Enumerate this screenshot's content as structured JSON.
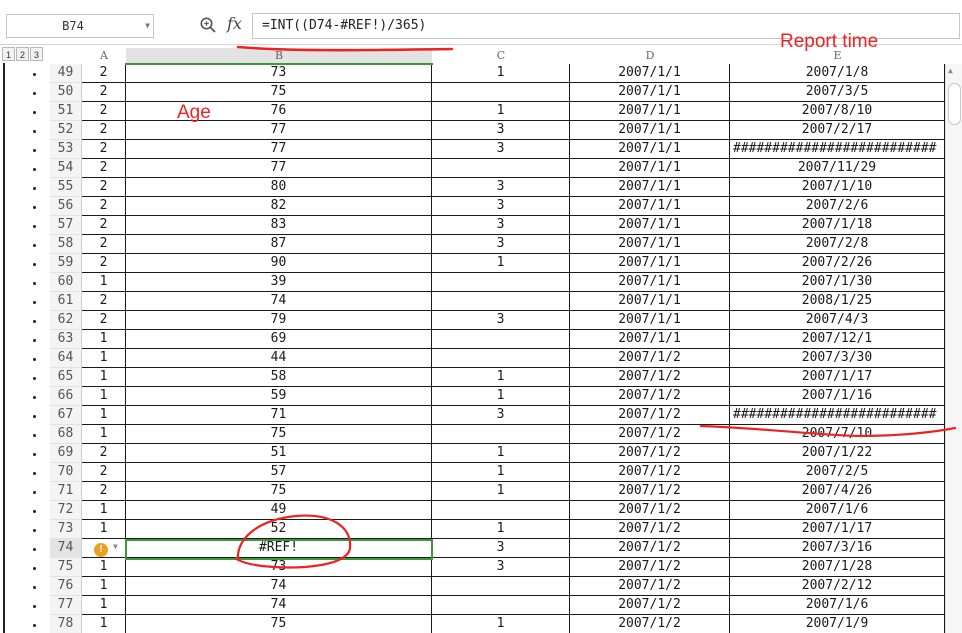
{
  "name_box": "B74",
  "formula": "=INT((D74-#REF!)/365)",
  "outline_levels": [
    "1",
    "2",
    "3"
  ],
  "columns": [
    "A",
    "B",
    "C",
    "D",
    "E"
  ],
  "rows": [
    {
      "n": "49",
      "a": "2",
      "b": "73",
      "c": "1",
      "d": "2007/1/1",
      "e": "2007/1/8"
    },
    {
      "n": "50",
      "a": "2",
      "b": "75",
      "c": "",
      "d": "2007/1/1",
      "e": "2007/3/5"
    },
    {
      "n": "51",
      "a": "2",
      "b": "76",
      "c": "1",
      "d": "2007/1/1",
      "e": "2007/8/10"
    },
    {
      "n": "52",
      "a": "2",
      "b": "77",
      "c": "3",
      "d": "2007/1/1",
      "e": "2007/2/17"
    },
    {
      "n": "53",
      "a": "2",
      "b": "77",
      "c": "3",
      "d": "2007/1/1",
      "e": "##########################"
    },
    {
      "n": "54",
      "a": "2",
      "b": "77",
      "c": "",
      "d": "2007/1/1",
      "e": "2007/11/29"
    },
    {
      "n": "55",
      "a": "2",
      "b": "80",
      "c": "3",
      "d": "2007/1/1",
      "e": "2007/1/10"
    },
    {
      "n": "56",
      "a": "2",
      "b": "82",
      "c": "3",
      "d": "2007/1/1",
      "e": "2007/2/6"
    },
    {
      "n": "57",
      "a": "2",
      "b": "83",
      "c": "3",
      "d": "2007/1/1",
      "e": "2007/1/18"
    },
    {
      "n": "58",
      "a": "2",
      "b": "87",
      "c": "3",
      "d": "2007/1/1",
      "e": "2007/2/8"
    },
    {
      "n": "59",
      "a": "2",
      "b": "90",
      "c": "1",
      "d": "2007/1/1",
      "e": "2007/2/26"
    },
    {
      "n": "60",
      "a": "1",
      "b": "39",
      "c": "",
      "d": "2007/1/1",
      "e": "2007/1/30"
    },
    {
      "n": "61",
      "a": "2",
      "b": "74",
      "c": "",
      "d": "2007/1/1",
      "e": "2008/1/25"
    },
    {
      "n": "62",
      "a": "2",
      "b": "79",
      "c": "3",
      "d": "2007/1/1",
      "e": "2007/4/3"
    },
    {
      "n": "63",
      "a": "1",
      "b": "69",
      "c": "",
      "d": "2007/1/1",
      "e": "2007/12/1"
    },
    {
      "n": "64",
      "a": "1",
      "b": "44",
      "c": "",
      "d": "2007/1/2",
      "e": "2007/3/30"
    },
    {
      "n": "65",
      "a": "1",
      "b": "58",
      "c": "1",
      "d": "2007/1/2",
      "e": "2007/1/17"
    },
    {
      "n": "66",
      "a": "1",
      "b": "59",
      "c": "1",
      "d": "2007/1/2",
      "e": "2007/1/16"
    },
    {
      "n": "67",
      "a": "1",
      "b": "71",
      "c": "3",
      "d": "2007/1/2",
      "e": "##########################"
    },
    {
      "n": "68",
      "a": "1",
      "b": "75",
      "c": "",
      "d": "2007/1/2",
      "e": "2007/7/10"
    },
    {
      "n": "69",
      "a": "2",
      "b": "51",
      "c": "1",
      "d": "2007/1/2",
      "e": "2007/1/22"
    },
    {
      "n": "70",
      "a": "2",
      "b": "57",
      "c": "1",
      "d": "2007/1/2",
      "e": "2007/2/5"
    },
    {
      "n": "71",
      "a": "2",
      "b": "75",
      "c": "1",
      "d": "2007/1/2",
      "e": "2007/4/26"
    },
    {
      "n": "72",
      "a": "1",
      "b": "49",
      "c": "",
      "d": "2007/1/2",
      "e": "2007/1/6"
    },
    {
      "n": "73",
      "a": "1",
      "b": "52",
      "c": "1",
      "d": "2007/1/2",
      "e": "2007/1/17"
    },
    {
      "n": "74",
      "a": "",
      "b": "#REF!",
      "c": "3",
      "d": "2007/1/2",
      "e": "2007/3/16"
    },
    {
      "n": "75",
      "a": "1",
      "b": "73",
      "c": "3",
      "d": "2007/1/2",
      "e": "2007/1/28"
    },
    {
      "n": "76",
      "a": "1",
      "b": "74",
      "c": "",
      "d": "2007/1/2",
      "e": "2007/2/12"
    },
    {
      "n": "77",
      "a": "1",
      "b": "74",
      "c": "",
      "d": "2007/1/2",
      "e": "2007/1/6"
    },
    {
      "n": "78",
      "a": "1",
      "b": "75",
      "c": "1",
      "d": "2007/1/2",
      "e": "2007/1/9"
    }
  ],
  "annotations": {
    "age": "Age",
    "report_time": "Report time"
  },
  "colors": {
    "annotation": "#ee2222",
    "selection": "#3a9a3a",
    "warning": "#f0a020"
  },
  "icons": {
    "zoom": "zoom-formula-icon",
    "fx": "fx",
    "warning": "!"
  }
}
